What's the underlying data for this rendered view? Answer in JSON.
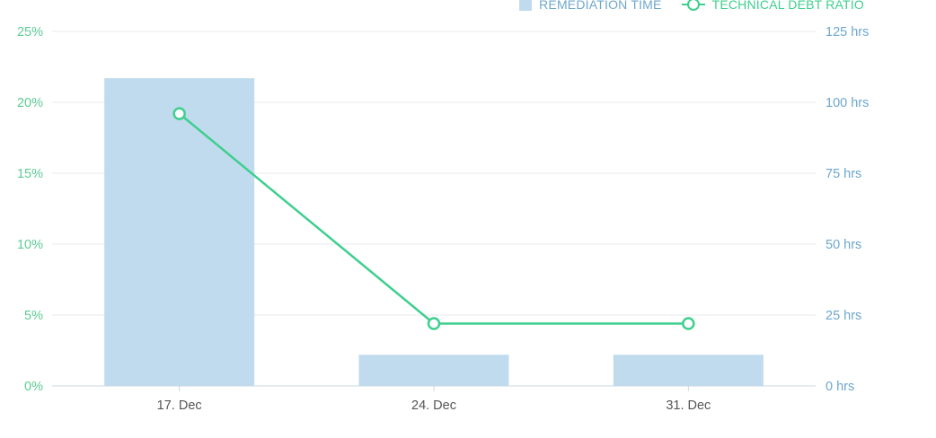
{
  "chart_data": {
    "type": "bar",
    "categories": [
      "17. Dec",
      "24. Dec",
      "31. Dec"
    ],
    "series": [
      {
        "name": "REMEDIATION TIME",
        "type": "bar",
        "axis": "right",
        "unit": "hrs",
        "values": [
          108.5,
          11,
          11
        ]
      },
      {
        "name": "TECHNICAL DEBT RATIO",
        "type": "line",
        "axis": "left",
        "unit": "%",
        "values": [
          19.2,
          4.4,
          4.4
        ]
      }
    ],
    "y_left": {
      "min": 0,
      "max": 25,
      "ticks": [
        "0%",
        "5%",
        "10%",
        "15%",
        "20%",
        "25%"
      ]
    },
    "y_right": {
      "min": 0,
      "max": 125,
      "ticks": [
        "0 hrs",
        "25 hrs",
        "50 hrs",
        "75 hrs",
        "100 hrs",
        "125 hrs"
      ]
    },
    "title": "",
    "xlabel": "",
    "legend_position": "top-right",
    "grid": true
  },
  "colors": {
    "bar": "#c0dbed",
    "line": "#3ecf8e",
    "left_axis_text": "#5ccc94",
    "right_axis_text": "#6ea7cc",
    "category_text": "#555555",
    "grid": "#e4e8ec",
    "baseline": "#c8d8e6"
  }
}
